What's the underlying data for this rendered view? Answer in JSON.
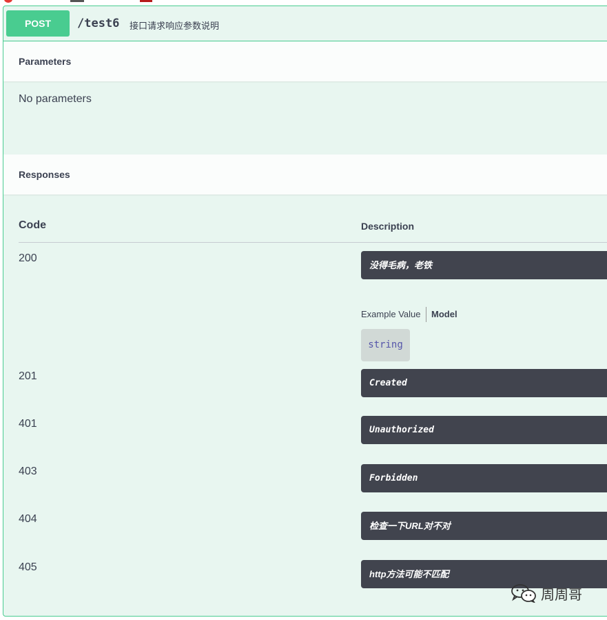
{
  "operation": {
    "method": "POST",
    "path": "/test6",
    "summary": "接口请求响应参数说明"
  },
  "parameters": {
    "title": "Parameters",
    "empty_text": "No parameters"
  },
  "responses": {
    "title": "Responses",
    "columns": {
      "code": "Code",
      "description": "Description"
    },
    "items": [
      {
        "code": "200",
        "description": "没得毛病，老铁"
      },
      {
        "code": "201",
        "description": "Created"
      },
      {
        "code": "401",
        "description": "Unauthorized"
      },
      {
        "code": "403",
        "description": "Forbidden"
      },
      {
        "code": "404",
        "description": "检查一下URL对不对"
      },
      {
        "code": "405",
        "description": "http方法可能不匹配"
      }
    ],
    "example_tabs": {
      "example_value": "Example Value",
      "model": "Model"
    },
    "example_value": "string"
  },
  "watermark": {
    "icon": "wechat-icon",
    "text": "周周哥"
  },
  "colors": {
    "post_accent": "#49cc90",
    "block_background": "#e8f6f0",
    "markdown_background": "#41444e"
  }
}
